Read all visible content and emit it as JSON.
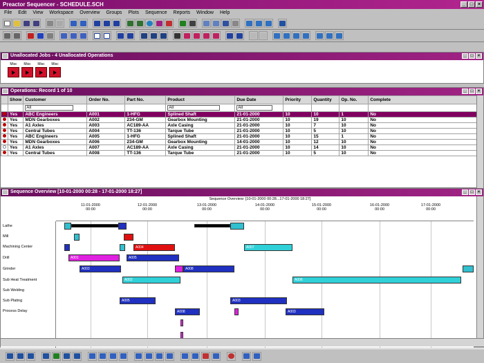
{
  "app": {
    "title": "Preactor Sequencer - SCHEDULE.SCH"
  },
  "menus": [
    "File",
    "Edit",
    "View",
    "Workspace",
    "Overview",
    "Groups",
    "Plots",
    "Sequence",
    "Reports",
    "Window",
    "Help"
  ],
  "unallocated": {
    "title": "Unallocated Jobs - 4 Unallocated Operations",
    "items": [
      {
        "label": "Misc"
      },
      {
        "label": "Misc"
      },
      {
        "label": "Misc"
      },
      {
        "label": "Misc"
      }
    ]
  },
  "operations": {
    "title": "Operations: Record 1 of 10",
    "columns": [
      "Show",
      "Customer",
      "Order No.",
      "Part No.",
      "Product",
      "Due Date",
      "Priority",
      "Quantity",
      "Op. No.",
      "Complete"
    ],
    "filters": {
      "customer": "All",
      "product": "All",
      "due_date": "All"
    },
    "rows": [
      {
        "show": "Yes",
        "customer": "ABC Engineers",
        "order": "A001",
        "part": "1-HFG",
        "product": "Splined Shaft",
        "due": "21-01-2000",
        "priority": "10",
        "qty": "10",
        "op": "1",
        "complete": "No"
      },
      {
        "show": "Yes",
        "customer": "MDN Gearboxes",
        "order": "A002",
        "part": "234-GM",
        "product": "Gearbox Mounting",
        "due": "21-01-2000",
        "priority": "10",
        "qty": "19",
        "op": "10",
        "complete": "No"
      },
      {
        "show": "Yes",
        "customer": "A1 Axles",
        "order": "A003",
        "part": "AC189-AA",
        "product": "Axle Casing",
        "due": "21-01-2000",
        "priority": "10",
        "qty": "7",
        "op": "10",
        "complete": "No"
      },
      {
        "show": "Yes",
        "customer": "Central Tubes",
        "order": "A004",
        "part": "TT-136",
        "product": "Tarque Tube",
        "due": "21-01-2000",
        "priority": "10",
        "qty": "5",
        "op": "10",
        "complete": "No"
      },
      {
        "show": "Yes",
        "customer": "ABC Engineers",
        "order": "A005",
        "part": "1-HFG",
        "product": "Splined Shaft",
        "due": "21-01-2000",
        "priority": "10",
        "qty": "15",
        "op": "1",
        "complete": "No"
      },
      {
        "show": "Yes",
        "customer": "MDN Gearboxes",
        "order": "A006",
        "part": "234-GM",
        "product": "Gearbox Mounting",
        "due": "14-01-2000",
        "priority": "10",
        "qty": "12",
        "op": "10",
        "complete": "No"
      },
      {
        "show": "Yes",
        "customer": "A1 Axles",
        "order": "A007",
        "part": "AC189-AA",
        "product": "Axle Casing",
        "due": "21-01-2000",
        "priority": "10",
        "qty": "14",
        "op": "10",
        "complete": "No"
      },
      {
        "show": "Yes",
        "customer": "Central Tubes",
        "order": "A008",
        "part": "TT-136",
        "product": "Tarque Tube",
        "due": "21-01-2000",
        "priority": "10",
        "qty": "5",
        "op": "10",
        "complete": "No"
      }
    ]
  },
  "sequence": {
    "title": "Sequence Overview [10-01-2000 00:28 - 17-01-2000 18:27]",
    "header_caption": "Sequence Overview: [10-01-2000 00:28...17-01-2000 18:27]",
    "dates": [
      {
        "d": "11-01-2000",
        "t": "00:00"
      },
      {
        "d": "12-01-2000",
        "t": "00:00"
      },
      {
        "d": "13-01-2000",
        "t": "00:00"
      },
      {
        "d": "14-01-2000",
        "t": "00:00"
      },
      {
        "d": "15-01-2000",
        "t": "00:00"
      },
      {
        "d": "16-01-2000",
        "t": "00:00"
      },
      {
        "d": "17-01-2000",
        "t": "00:00"
      }
    ],
    "resources": [
      "Lathe",
      "Mill",
      "Machining Center",
      "Drill",
      "Grinder",
      "Sub Heat Treatment",
      "Sub Welding",
      "Sub Plating",
      "Process Delay"
    ],
    "bar_labels": {
      "a001": "A001",
      "a002": "A002",
      "a003": "A003",
      "a004": "A004",
      "a005": "A005",
      "a006": "A006",
      "a007": "A007",
      "a008": "A008"
    }
  },
  "colors": {
    "title": "#a02384",
    "selected_row": "#800060",
    "dot": "#c00000"
  }
}
